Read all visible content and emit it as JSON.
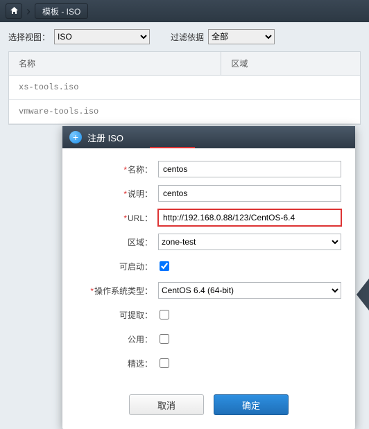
{
  "header": {
    "breadcrumb": "模板 - ISO"
  },
  "filter": {
    "view_label": "选择视图：",
    "view_value": "ISO",
    "filter_label": "过滤依据",
    "filter_value": "全部"
  },
  "table": {
    "col_name": "名称",
    "col_zone": "区域",
    "row1": "xs-tools.iso",
    "row2": "vmware-tools.iso"
  },
  "modal": {
    "title": "注册 ISO",
    "labels": {
      "name": "名称：",
      "desc": "说明：",
      "url": "URL：",
      "zone": "区域：",
      "bootable": "可启动：",
      "os": "操作系统类型：",
      "extract": "可提取：",
      "public": "公用：",
      "featured": "精选："
    },
    "values": {
      "name": "centos",
      "desc": "centos",
      "url": "http://192.168.0.88/123/CentOS-6.4",
      "zone": "zone-test",
      "os": "CentOS 6.4 (64-bit)"
    },
    "buttons": {
      "cancel": "取消",
      "ok": "确定"
    }
  }
}
